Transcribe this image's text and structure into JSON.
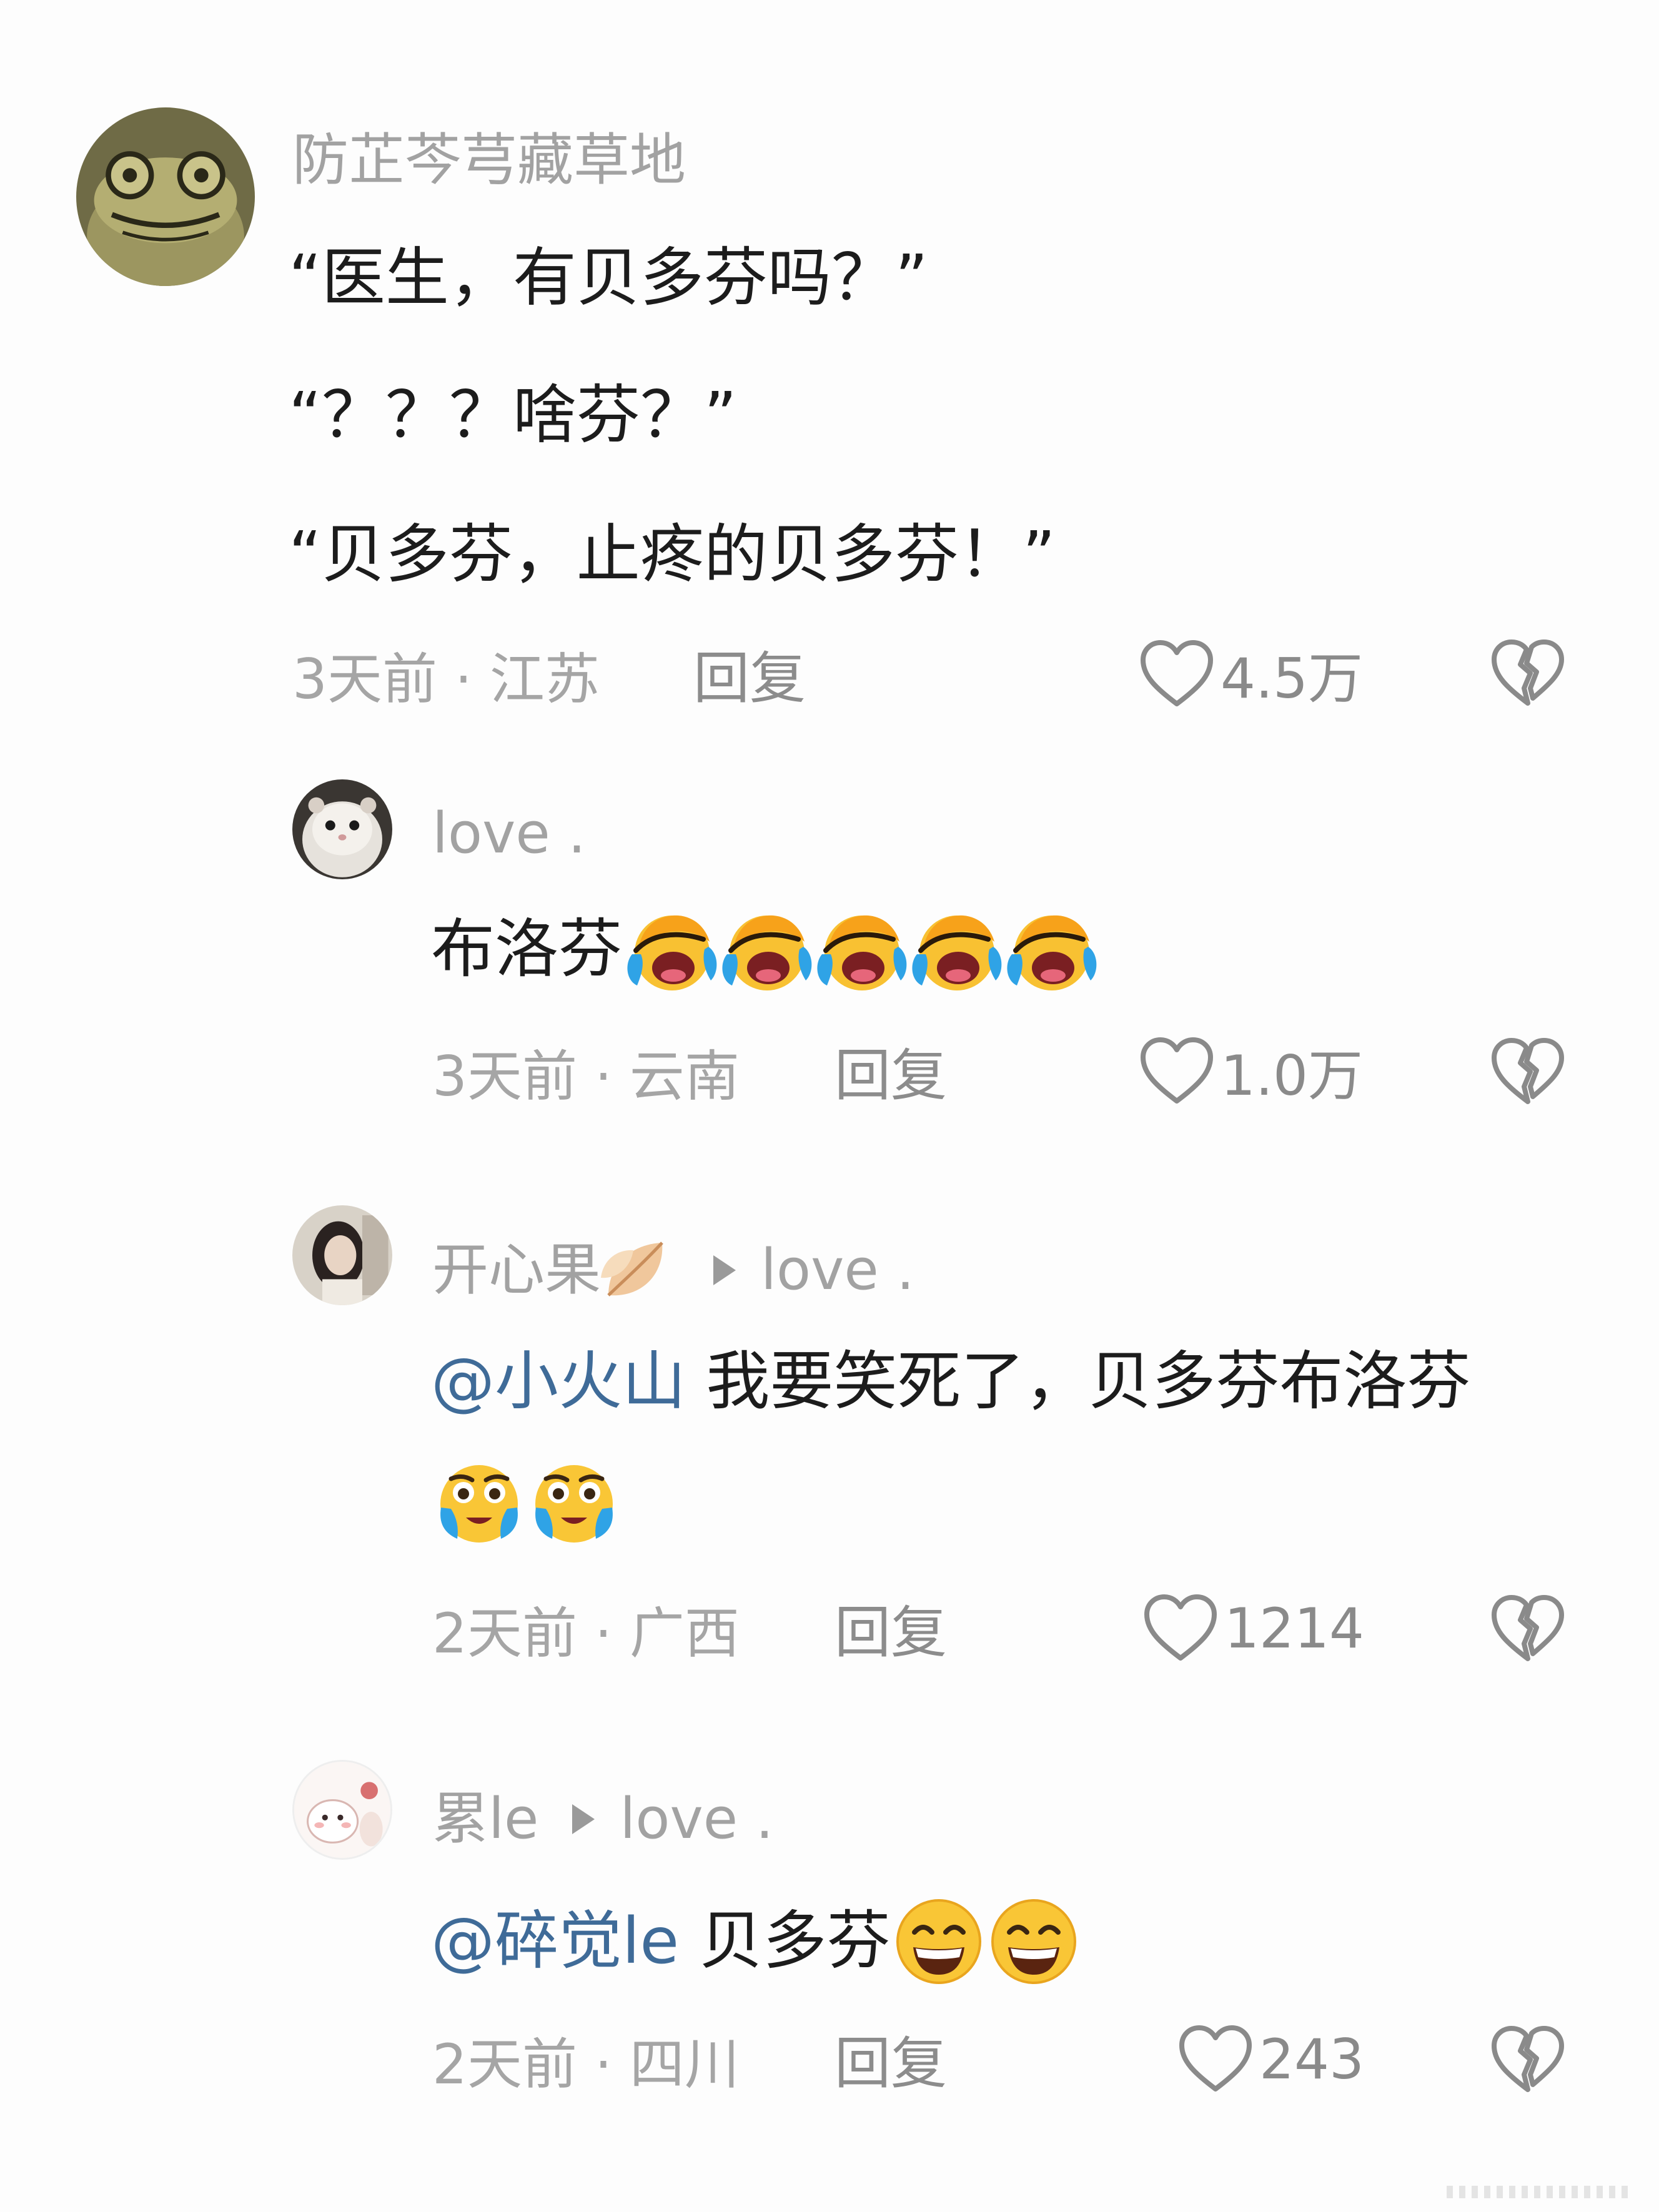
{
  "comments": [
    {
      "user": "防芷芩芎藏草地",
      "lines": [
        "“医生，有贝多芬吗？”",
        "“？？？啥芬？”",
        "“贝多芬，止疼的贝多芬！”"
      ],
      "time_location": "3天前 · 江苏",
      "reply": "回复",
      "likes": "4.5万"
    },
    {
      "user": "love .",
      "text": "布洛芬",
      "emojis": [
        "laughing-crying",
        "laughing-crying",
        "laughing-crying",
        "laughing-crying",
        "laughing-crying"
      ],
      "time_location": "3天前 · 云南",
      "reply": "回复",
      "likes": "1.0万"
    },
    {
      "user": "开心果",
      "reply_to": "love .",
      "mention": "@小火山",
      "text": " 我要笑死了，贝多芬布洛芬",
      "emojis": [
        "teary-smile",
        "teary-smile"
      ],
      "time_location": "2天前 · 广西",
      "reply": "回复",
      "likes": "1214"
    },
    {
      "user": "累le",
      "reply_to": "love .",
      "mention": "@碎觉le",
      "text": " 贝多芬",
      "emojis": [
        "grinning",
        "grinning"
      ],
      "time_location": "2天前 · 四川",
      "reply": "回复",
      "likes": "243"
    }
  ],
  "icons": [
    "heart-outline-icon",
    "broken-heart-icon",
    "leaf-icon"
  ],
  "colors": {
    "mention": "#3f6b98",
    "meta": "#a5a5a5",
    "text": "#1c1c1c"
  }
}
